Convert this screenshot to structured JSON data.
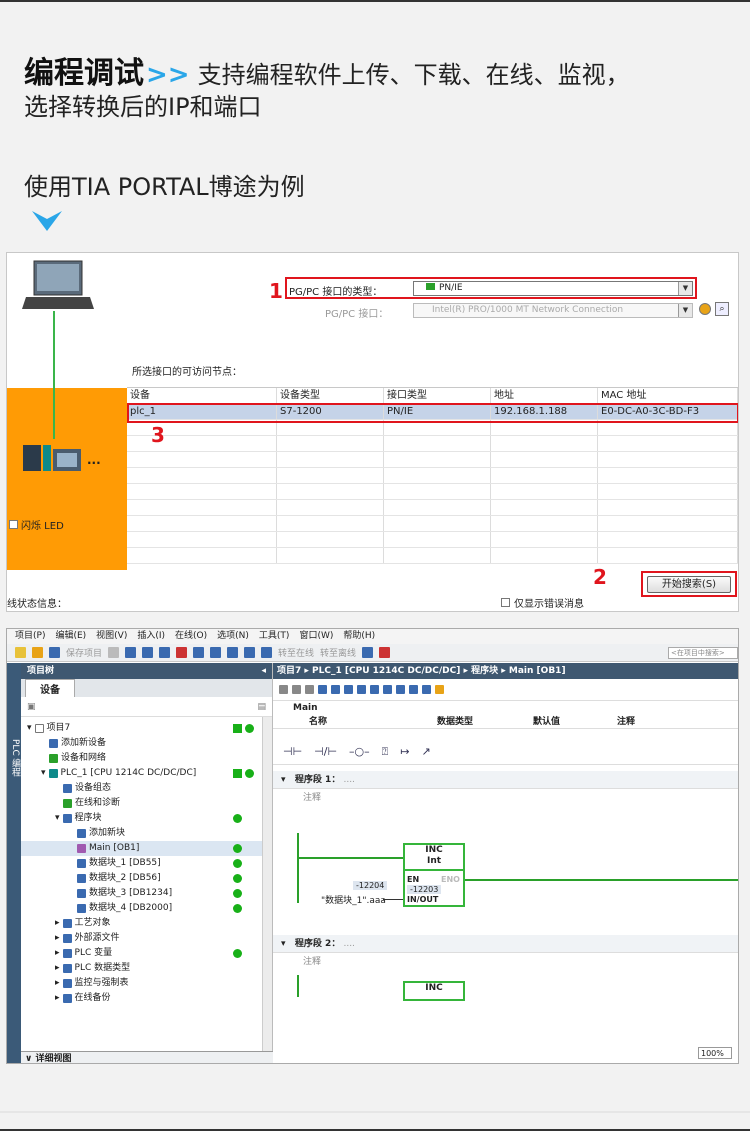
{
  "heading": {
    "strong": "编程调试",
    "arrows": ">>",
    "line1_rest": "支持编程软件上传、下载、在线、监视，",
    "line2": "选择转换后的IP和端口"
  },
  "subheading": "使用TIA PORTAL博途为例",
  "shot1": {
    "if_type_label": "PG/PC 接口的类型：",
    "if_type_value": "PN/IE",
    "if_label": "PG/PC 接口：",
    "if_value": "Intel(R) PRO/1000 MT Network Connection",
    "nodes_label": "所选接口的可访问节点：",
    "columns": [
      "设备",
      "设备类型",
      "接口类型",
      "地址",
      "MAC 地址"
    ],
    "row": {
      "device": "plc_1",
      "type": "S7-1200",
      "iface": "PN/IE",
      "address": "192.168.1.188",
      "mac": "E0-DC-A0-3C-BD-F3"
    },
    "led_label": "闪烁 LED",
    "search_button": "开始搜索(S)",
    "status_label": "线状态信息：",
    "only_errors": "仅显示错误消息",
    "annotations": [
      "1",
      "2",
      "3"
    ],
    "plc_dots": "..."
  },
  "shot2": {
    "menu": [
      "项目(P)",
      "编辑(E)",
      "视图(V)",
      "插入(I)",
      "在线(O)",
      "选项(N)",
      "工具(T)",
      "窗口(W)",
      "帮助(H)"
    ],
    "toolbar": {
      "save": "保存项目",
      "go_online": "转至在线",
      "go_offline": "转至离线",
      "search_placeholder": "<在项目中搜索>"
    },
    "side_label": "PLC 编程",
    "tree_title": "项目树",
    "tree_tab": "设备",
    "tree_items": [
      "项目7",
      "添加新设备",
      "设备和网络",
      "PLC_1 [CPU 1214C DC/DC/DC]",
      "设备组态",
      "在线和诊断",
      "程序块",
      "添加新块",
      "Main [OB1]",
      "数据块_1 [DB55]",
      "数据块_2 [DB56]",
      "数据块_3 [DB1234]",
      "数据块_4 [DB2000]",
      "工艺对象",
      "外部源文件",
      "PLC 变量",
      "PLC 数据类型",
      "监控与强制表",
      "在线备份"
    ],
    "tree_footer": "详细视图",
    "breadcrumb": "项目7 ▸ PLC_1 [CPU 1214C DC/DC/DC] ▸ 程序块 ▸ Main [OB1]",
    "block_name": "Main",
    "iface_cols": [
      "名称",
      "数据类型",
      "默认值",
      "注释"
    ],
    "segment1": "程序段 1：",
    "segment1_dots": "....",
    "segment2": "程序段 2：",
    "segment2_dots": "....",
    "comment": "注释",
    "inc_title": "INC",
    "inc_type": "Int",
    "pin_en": "EN",
    "pin_eno": "ENO",
    "pin_inout": "IN/OUT",
    "monitor_value": "-12204",
    "inout_value": "-12203",
    "operand": "\"数据块_1\".aaa",
    "zoom": "100%"
  }
}
